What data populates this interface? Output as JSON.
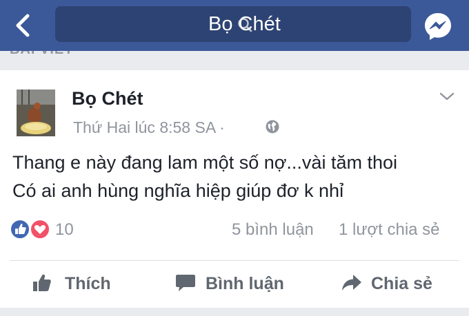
{
  "topbar": {
    "search_text": "Bọ Chét"
  },
  "section": {
    "label": "BÀI VIẾT"
  },
  "post": {
    "author": "Bọ Chét",
    "timestamp": "Thứ Hai lúc 8:58 SA",
    "separator": "·",
    "text_lines": [
      "Thang e này đang lam một số nợ...vài tăm thoi",
      "Có ai anh hùng nghĩa hiệp giúp đơ k nhỉ"
    ],
    "reaction_count": "10",
    "comment_count": "5 bình luận",
    "share_count": "1 lượt chia sẻ"
  },
  "actions": {
    "like_label": "Thích",
    "comment_label": "Bình luận",
    "share_label": "Chia sẻ"
  },
  "colors": {
    "brand": "#3b5998",
    "like_blue": "#4267b2",
    "love_red": "#f25268"
  },
  "icons": [
    "back-arrow-icon",
    "search-icon",
    "messenger-icon",
    "globe-icon",
    "chevron-down-icon",
    "like-reaction-icon",
    "love-reaction-icon",
    "thumbs-up-icon",
    "comment-icon",
    "share-icon"
  ]
}
